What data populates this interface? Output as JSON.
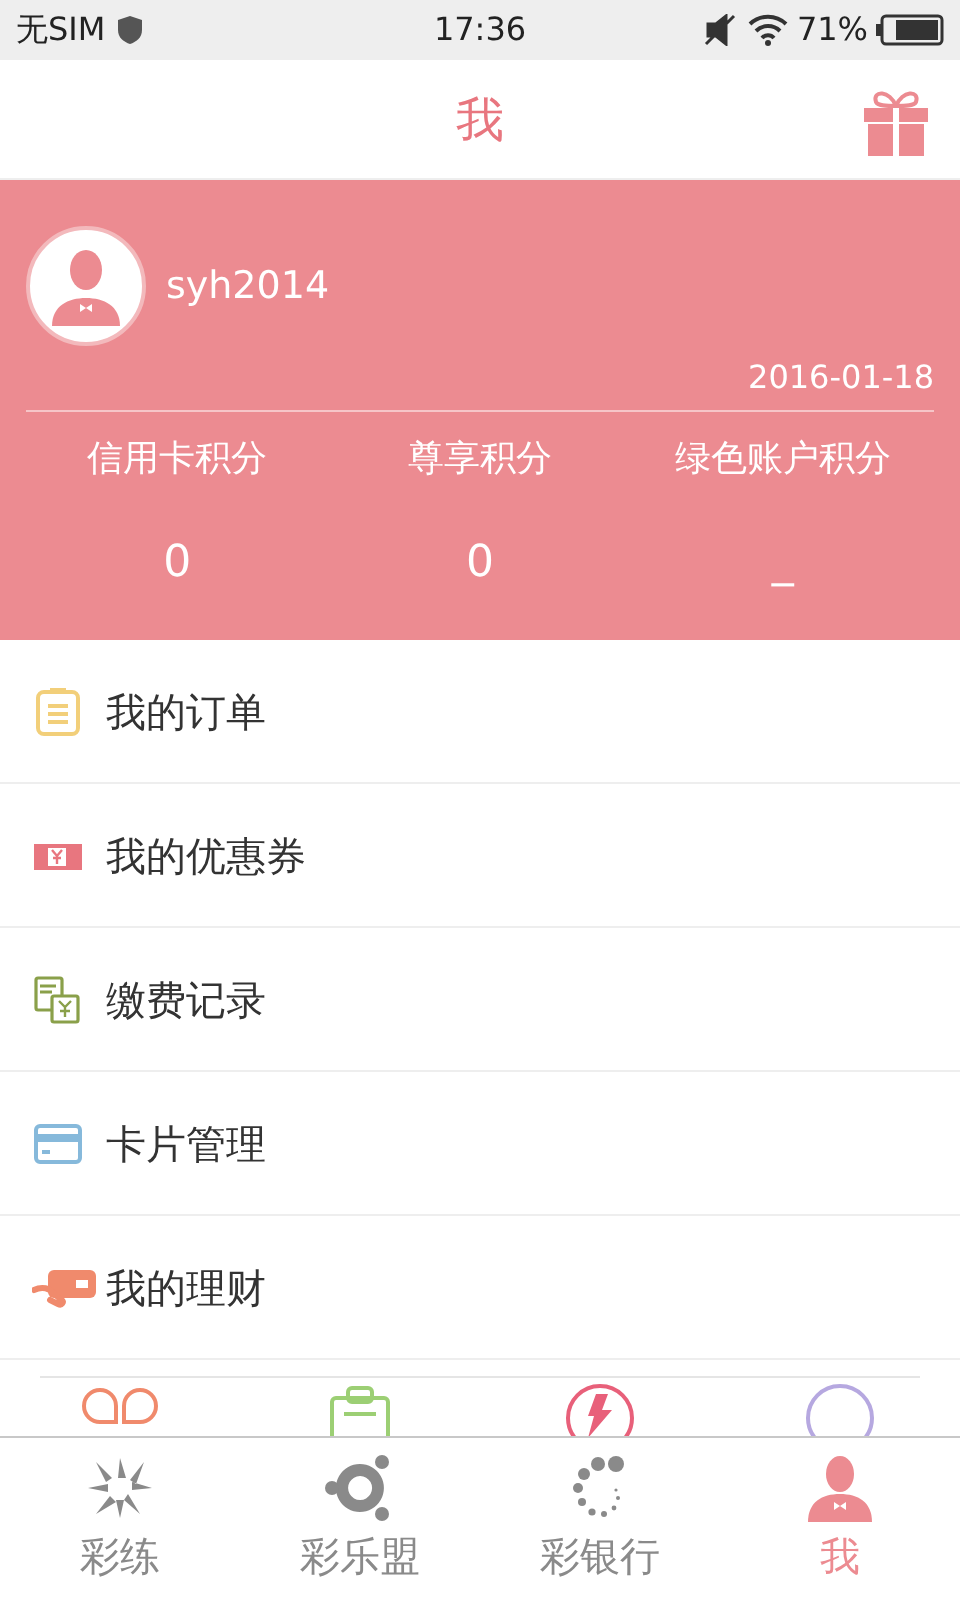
{
  "status_bar": {
    "carrier": "无SIM",
    "time": "17:36",
    "battery": "71%"
  },
  "header": {
    "title": "我"
  },
  "profile": {
    "username": "syh2014",
    "date": "2016-01-18",
    "points": [
      {
        "label": "信用卡积分",
        "value": "0"
      },
      {
        "label": "尊享积分",
        "value": "0"
      },
      {
        "label": "绿色账户积分",
        "value": "_"
      }
    ]
  },
  "menu": [
    {
      "label": "我的订单"
    },
    {
      "label": "我的优惠券"
    },
    {
      "label": "缴费记录"
    },
    {
      "label": "卡片管理"
    },
    {
      "label": "我的理财"
    }
  ],
  "tabs": [
    {
      "label": "彩练",
      "selected": false
    },
    {
      "label": "彩乐盟",
      "selected": false
    },
    {
      "label": "彩银行",
      "selected": false
    },
    {
      "label": "我",
      "selected": true
    }
  ]
}
